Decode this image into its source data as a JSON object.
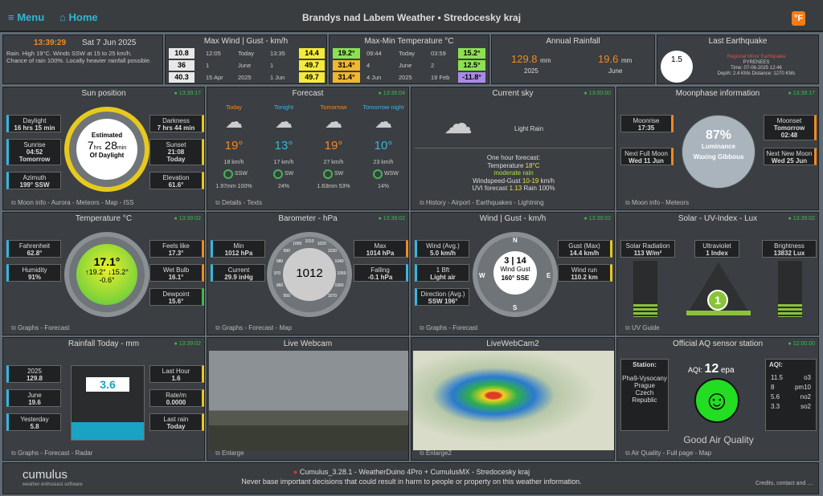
{
  "topbar": {
    "menu": "Menu",
    "home": "Home",
    "title": "Brandys nad Labem Weather  •  Stredocesky kraj",
    "unit_button": "°F"
  },
  "summary": {
    "time": "13:39:29",
    "date": "Sat 7 Jun 2025",
    "text1": "Rain. High 19°C. Winds SSW at 15 to 25 km/h.",
    "text2": "Chance of rain 100%. Locally heavier rainfall possible."
  },
  "maxwind": {
    "title": "Max Wind | Gust - km/h",
    "rows": [
      [
        "10.8",
        "12:05",
        "Today",
        "13:35",
        "14.4"
      ],
      [
        "36",
        "1",
        "June",
        "1",
        "49.7"
      ],
      [
        "40.3",
        "15 Apr",
        "2025",
        "1 Jun",
        "49.7"
      ]
    ]
  },
  "maxmin": {
    "title": "Max-Min Temperature °C",
    "rows": [
      [
        "19.2°",
        "09:44",
        "Today",
        "03:59",
        "15.2°"
      ],
      [
        "31.4°",
        "4",
        "June",
        "2",
        "12.5°"
      ],
      [
        "31.4°",
        "4 Jun",
        "2025",
        "19 Feb",
        "-11.8°"
      ]
    ]
  },
  "annual": {
    "title": "Annual Rainfall",
    "v1": "129.8",
    "u1": "mm",
    "l1": "2025",
    "v2": "19.6",
    "u2": "mm",
    "l2": "June"
  },
  "quake": {
    "title": "Last Earthquake",
    "mag": "1.5",
    "name": "Regional Minor Earthquake",
    "region": "PYRENEES",
    "time": "Time: 07-06-2025 12:46",
    "depth": "Depth: 2.4 KMs Distance: 1270 KMs"
  },
  "sun": {
    "title": "Sun position",
    "upd": "13:39:17",
    "daylight_l": "Daylight",
    "daylight": "16 hrs 15 min",
    "sunrise_l": "Sunrise",
    "sunrise": "04:52",
    "sunrise2": "Tomorrow",
    "azimuth_l": "Azimuth",
    "azimuth": "199° SSW",
    "darkness_l": "Darkness",
    "darkness": "7 hrs 44 min",
    "sunset_l": "Sunset",
    "sunset": "21:08",
    "sunset2": "Today",
    "elev_l": "Elevation",
    "elev": "61.6°",
    "est": "Estimated",
    "h": "7",
    "hrs": "hrs",
    "m": "28",
    "min": "min",
    "od": "Of Daylight",
    "foot": "Moon info - Aurora - Meteors - Map - ISS"
  },
  "forecast": {
    "title": "Forecast",
    "upd": "13:35:04",
    "cols": [
      {
        "name": "Today",
        "temp": "19°",
        "wind": "18 km/h",
        "dir": "SSW",
        "rain": "1.97mm 100%"
      },
      {
        "name": "Tonight",
        "temp": "13°",
        "wind": "17 km/h",
        "dir": "SW",
        "rain": "24%"
      },
      {
        "name": "Tomorrow",
        "temp": "19°",
        "wind": "27 km/h",
        "dir": "SW",
        "rain": "1.63mm 53%"
      },
      {
        "name": "Tomorrow night",
        "temp": "10°",
        "wind": "23 km/h",
        "dir": "WSW",
        "rain": "14%"
      }
    ],
    "foot": "Details - Texts"
  },
  "sky": {
    "title": "Current sky",
    "upd": "13:00:00",
    "cond": "Light Rain",
    "l1": "One hour forecast:",
    "l2a": "Temperature",
    "l2b": "18°C",
    "l3": "moderate rain",
    "l4a": "Windspeed-Gust",
    "l4b": "10-19",
    "l4c": "km/h",
    "l5a": "UVI forecast",
    "l5b": "1.13",
    "l5c": "Rain",
    "l5d": "100%",
    "foot": "History - Airport - Earthquakes - Lightning"
  },
  "moon": {
    "title": "Moonphase information",
    "upd": "13:39:17",
    "rise_l": "Moonrise",
    "rise": "17:35",
    "set_l": "Moonset",
    "set2": "Tomorrow",
    "set": "02:48",
    "full_l": "Next Full Moon",
    "full": "Wed 11 Jun",
    "new_l": "Next New Moon",
    "new": "Wed 25 Jun",
    "pct": "87%",
    "lum": "Luminance",
    "phase": "Waxing Gibbous",
    "foot": "Moon info - Meteors"
  },
  "temp": {
    "title": "Temperature °C",
    "upd": "13:39:02",
    "f_l": "Fahrenheit",
    "f": "62.8°",
    "h_l": "Humidity",
    "h": "91%",
    "fl_l": "Feels like",
    "fl": "17.3°",
    "wb_l": "Wet Bulb",
    "wb": "16.1°",
    "dp_l": "Dewpoint",
    "dp": "15.6°",
    "cur": "17.1°",
    "hi": "↑19.2°",
    "lo": "↓15.2°",
    "trend": "-0.6°",
    "foot": "Graphs - Forecast"
  },
  "baro": {
    "title": "Barometer - hPa",
    "upd": "13:39:02",
    "min_l": "Min",
    "min": "1012 hPa",
    "cur_l": "Current",
    "cur": "29.9 inHg",
    "max_l": "Max",
    "max": "1014 hPa",
    "fall_l": "Falling",
    "fall": "-0.1 hPa",
    "val": "1012",
    "ticks": [
      "950",
      "960",
      "970",
      "980",
      "990",
      "1000",
      "1010",
      "1020",
      "1030",
      "1040",
      "1050",
      "1060",
      "1070"
    ],
    "foot": "Graphs - Forecast - Map"
  },
  "wind": {
    "title": "Wind | Gust - km/h",
    "upd": "13:39:02",
    "avg_l": "Wind (Avg.)",
    "avg": "5.0 km/h",
    "bf_l": "1 Bft",
    "bf": "Light air",
    "dir_l": "Direction (Avg.)",
    "dir": "SSW 196°",
    "gust_l": "Gust (Max)",
    "gust": "14.4 km/h",
    "run_l": "Wind run",
    "run": "110.2 km",
    "w": "3",
    "g": "14",
    "wl": "Wind",
    "gl": "Gust",
    "deg": "160° SSE",
    "n": "N",
    "e": "E",
    "s": "S",
    "wst": "W",
    "foot": "Graphs - Forecast"
  },
  "solar": {
    "title": "Solar - UV-Index - Lux",
    "upd": "13:39:02",
    "sr_l": "Solar Radiation",
    "sr": "113 W/m²",
    "uv_l": "Ultraviolet",
    "uv": "1 Index",
    "br_l": "Brightness",
    "br": "13832 Lux",
    "uvnum": "1",
    "foot": "UV Guide"
  },
  "rain": {
    "title": "Rainfall Today - mm",
    "upd": "13:39:02",
    "y_l": "2025",
    "y": "129.8",
    "m_l": "June",
    "m": "19.6",
    "yd_l": "Yesterday",
    "yd": "5.8",
    "lh_l": "Last Hour",
    "lh": "1.6",
    "rate_l": "Rate/m",
    "rate": "0.0000",
    "last_l": "Last rain",
    "last": "Today",
    "val": "3.6",
    "foot": "Graphs - Forecast - Radar"
  },
  "webcam": {
    "title": "Live Webcam",
    "foot": "Enlarge"
  },
  "webcam2": {
    "title": "LiveWebCam2",
    "foot": "Enlarge2"
  },
  "aq": {
    "title": "Official AQ sensor station",
    "upd": "12:00:00",
    "st_l": "Station:",
    "st": [
      "Pha9-Vysocany",
      "Prague",
      "Czech",
      "Republic"
    ],
    "aqi_l": "AQI:",
    "aqi": "12",
    "aqi_u": "epa",
    "rows": [
      [
        "11.5",
        "o3"
      ],
      [
        "8",
        "pm10"
      ],
      [
        "5.6",
        "no2"
      ],
      [
        "3.3",
        "so2"
      ]
    ],
    "good": "Good Air Quality",
    "foot": "Air Quality - Full page - Map"
  },
  "footer": {
    "line1": "Cumulus_3.28.1  -  WeatherDuino 4Pro + CumulusMX  -  Stredocesky kraj",
    "line2": "Never base important decisions that could result in harm to people or property on this weather information.",
    "credits": "Credits, contact and ....",
    "logo": "cumulus",
    "tag": "weather enthusiast software"
  }
}
